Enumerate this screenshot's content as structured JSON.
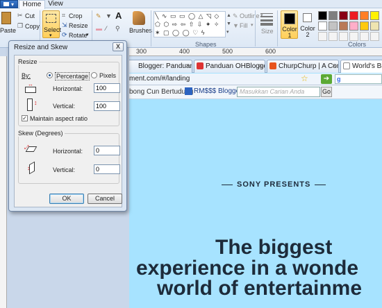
{
  "ribbon": {
    "tabs": [
      "Home",
      "View"
    ],
    "clipboard": {
      "paste": "Paste",
      "cut": "Cut",
      "copy": "Copy"
    },
    "image": {
      "select": "Select",
      "crop": "Crop",
      "resize": "Resize",
      "rotate": "Rotate"
    },
    "brushes": "Brushes",
    "shapes": {
      "outline": "Outline",
      "fill": "Fill",
      "group_label": "Shapes"
    },
    "size": "Size",
    "color1": "Color\n1",
    "color2": "Color\n2",
    "colors_group": "Colors",
    "palette": [
      "#000000",
      "#7f7f7f",
      "#880015",
      "#ed1c24",
      "#ff7f27",
      "#fff200",
      "#22b14c",
      "#ffffff",
      "#c3c3c3",
      "#b97a57",
      "#ffaec9",
      "#ffc90e",
      "#efe4b0",
      "#b5e61d"
    ]
  },
  "ruler": {
    "ticks": [
      "300",
      "400",
      "500",
      "600"
    ]
  },
  "browser": {
    "tabs": [
      {
        "label": "Blogger: Panduan OH...",
        "color": "#f57d00"
      },
      {
        "label": "Panduan OHBlogger B...",
        "color": "#d33"
      },
      {
        "label": "ChurpChurp | A Com...",
        "color": "#e8541c"
      },
      {
        "label": "World's Bigge",
        "color": "#fff"
      }
    ],
    "url": "ment.com/#/landing",
    "bookmark1": "bong Cun Bertudung",
    "bookmark2": "RM$$$ Blogger",
    "search_placeholder": "Masukkan Carian Anda",
    "go_label": "Go",
    "presents": "SONY PRESENTS",
    "headline": [
      "The biggest",
      "experience in a wonde",
      "world of entertainme"
    ]
  },
  "dialog": {
    "title": "Resize and Skew",
    "close": "X",
    "resize_label": "Resize",
    "by_label": "By:",
    "percentage": "Percentage",
    "pixels": "Pixels",
    "horizontal": "Horizontal:",
    "vertical": "Vertical:",
    "h_value": "100",
    "v_value": "100",
    "maintain": "Maintain aspect ratio",
    "skew_label": "Skew (Degrees)",
    "skew_h": "Horizontal:",
    "skew_v": "Vertical:",
    "skew_h_value": "0",
    "skew_v_value": "0",
    "ok": "OK",
    "cancel": "Cancel"
  }
}
